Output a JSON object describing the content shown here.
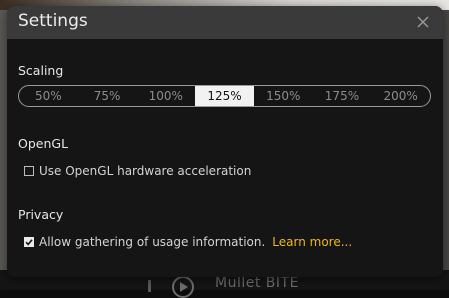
{
  "background": {
    "ghost_text": "Mullet BITE"
  },
  "dialog": {
    "title": "Settings",
    "close_icon": "close-icon"
  },
  "scaling": {
    "label": "Scaling",
    "options": [
      "50%",
      "75%",
      "100%",
      "125%",
      "150%",
      "175%",
      "200%"
    ],
    "selected": "125%"
  },
  "opengl": {
    "label": "OpenGL",
    "checkbox_label": "Use OpenGL hardware acceleration",
    "checked": false
  },
  "privacy": {
    "label": "Privacy",
    "checkbox_label": "Allow gathering of usage information.",
    "link_text": "Learn more...",
    "checked": true
  },
  "colors": {
    "accent_link": "#f0b71c",
    "dialog_bg": "#151515",
    "titlebar_bg": "#3a3a3a",
    "segment_active_bg": "#f2f2f2"
  }
}
